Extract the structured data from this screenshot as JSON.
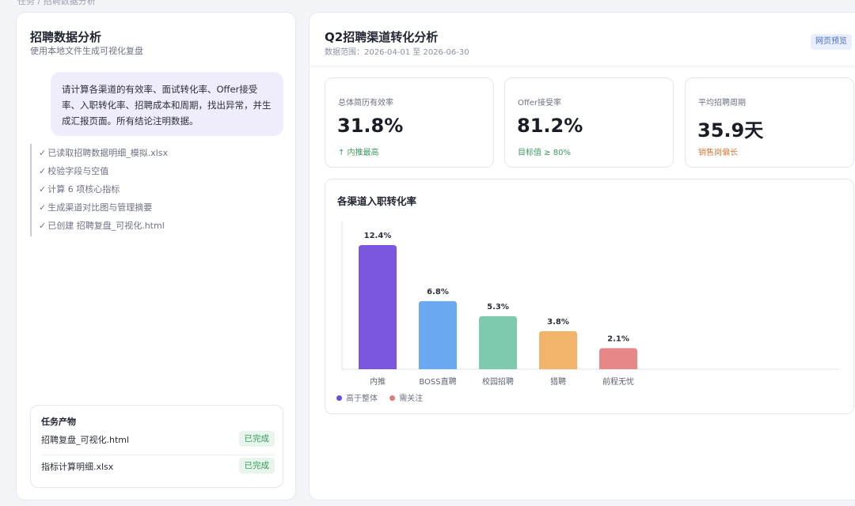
{
  "breadcrumb": "任务 / 招聘数据分析",
  "left": {
    "title": "招聘数据分析",
    "subtitle": "使用本地文件生成可视化复盘",
    "user_message": "请计算各渠道的有效率、面试转化率、Offer接受率、入职转化率、招聘成本和周期，找出异常，并生成汇报页面。所有结论注明数据。",
    "steps": [
      "已读取招聘数据明细_模拟.xlsx",
      "校验字段与空值",
      "计算 6 项核心指标",
      "生成渠道对比图与管理摘要",
      "已创建 招聘复盘_可视化.html"
    ],
    "check_glyph": "✓",
    "artifacts": {
      "title": "任务产物",
      "items": [
        {
          "name": "招聘复盘_可视化.html",
          "status": "已完成"
        },
        {
          "name": "指标计算明细.xlsx",
          "status": "已完成"
        }
      ]
    }
  },
  "right": {
    "title": "Q2招聘渠道转化分析",
    "range": "数据范围：2026-04-01 至 2026-06-30",
    "preview_label": "网页预览",
    "kpis": [
      {
        "label": "总体简历有效率",
        "value": "31.8%",
        "note": "↑ 内推最高",
        "note_color": "#3b9a5e"
      },
      {
        "label": "Offer接受率",
        "value": "81.2%",
        "note": "目标值 ≥ 80%",
        "note_color": "#3b9a5e"
      },
      {
        "label": "平均招聘周期",
        "value": "35.9天",
        "note": "销售岗偏长",
        "note_color": "#d07a3a"
      }
    ]
  },
  "chart_data": {
    "type": "bar",
    "title": "各渠道入职转化率",
    "categories": [
      "内推",
      "BOSS直聘",
      "校园招聘",
      "猎聘",
      "前程无忧"
    ],
    "values": [
      12.4,
      6.8,
      5.3,
      3.8,
      2.1
    ],
    "value_labels": [
      "12.4%",
      "6.8%",
      "5.3%",
      "3.8%",
      "2.1%"
    ],
    "bar_colors": [
      "#7b57e0",
      "#6aa8f2",
      "#7ecaae",
      "#f1b46a",
      "#e88787"
    ],
    "ylim": [
      0,
      12.4
    ],
    "grid": false,
    "legend": [
      {
        "name": "高于整体",
        "color": "#6a4fd6"
      },
      {
        "name": "需关注",
        "color": "#e07b7b"
      }
    ],
    "legend_placement": "bottom-left"
  }
}
